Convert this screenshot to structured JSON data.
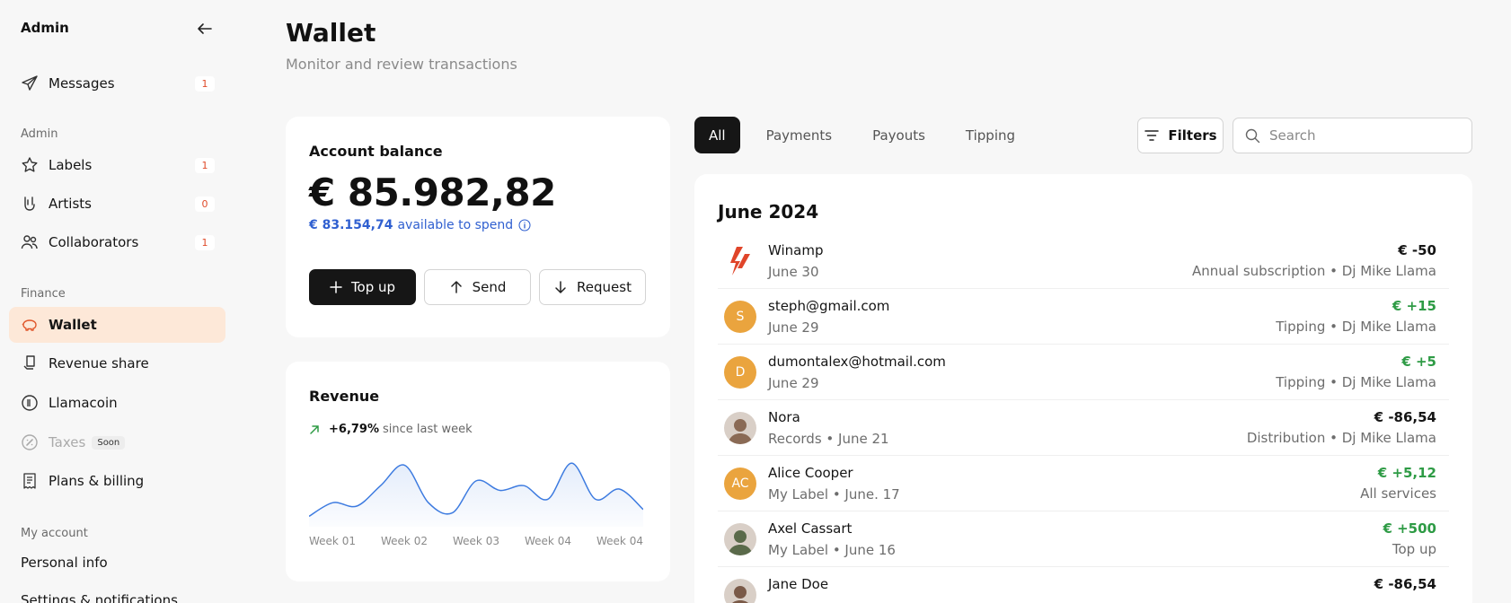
{
  "sidebar": {
    "header": "Admin",
    "top_items": [
      {
        "label": "Messages",
        "badge": "1"
      }
    ],
    "admin_section": "Admin",
    "admin_items": [
      {
        "label": "Labels",
        "badge": "1"
      },
      {
        "label": "Artists",
        "badge": "0"
      },
      {
        "label": "Collaborators",
        "badge": "1"
      }
    ],
    "finance_section": "Finance",
    "finance_items": [
      {
        "label": "Wallet"
      },
      {
        "label": "Revenue share"
      },
      {
        "label": "Llamacoin"
      },
      {
        "label": "Taxes",
        "tag": "Soon"
      },
      {
        "label": "Plans & billing"
      }
    ],
    "account_section": "My account",
    "account_items": [
      {
        "label": "Personal info"
      },
      {
        "label": "Settings & notifications"
      }
    ]
  },
  "header": {
    "title": "Wallet",
    "subtitle": "Monitor and review transactions"
  },
  "balance": {
    "title": "Account balance",
    "amount": "€ 85.982,82",
    "available_amount": "€ 83.154,74",
    "available_text": "available to spend",
    "buttons": {
      "top_up": "Top up",
      "send": "Send",
      "request": "Request"
    }
  },
  "revenue": {
    "title": "Revenue",
    "change": "+6,79%",
    "change_text": "since last week"
  },
  "chart_data": {
    "type": "area",
    "title": "Revenue",
    "categories": [
      "Week 01",
      "Week 02",
      "Week 03",
      "Week 04",
      "Week 04"
    ],
    "series": [
      {
        "values": [
          10,
          30,
          25,
          55,
          85,
          30,
          15,
          62,
          48,
          55,
          35,
          88,
          35,
          50,
          20
        ]
      }
    ],
    "ylim": [
      0,
      100
    ],
    "grid": false,
    "color": "#3d7be0"
  },
  "tabs": [
    "All",
    "Payments",
    "Payouts",
    "Tipping"
  ],
  "filters_label": "Filters",
  "search": {
    "placeholder": "Search"
  },
  "transactions": {
    "month": "June 2024",
    "rows": [
      {
        "name": "Winamp",
        "sub": "June 30",
        "amount": "€ -50",
        "desc": "Annual subscription • Dj Mike Llama",
        "positive": false,
        "avatar": "winamp-logo",
        "initials": ""
      },
      {
        "name": "steph@gmail.com",
        "sub": "June 29",
        "amount": "€ +15",
        "desc": "Tipping • Dj Mike Llama",
        "positive": true,
        "avatar": "initials",
        "initials": "S"
      },
      {
        "name": "dumontalex@hotmail.com",
        "sub": "June 29",
        "amount": "€ +5",
        "desc": "Tipping • Dj Mike Llama",
        "positive": true,
        "avatar": "initials",
        "initials": "D"
      },
      {
        "name": "Nora",
        "sub": "Records • June 21",
        "amount": "€ -86,54",
        "desc": "Distribution • Dj Mike Llama",
        "positive": false,
        "avatar": "photo",
        "initials": ""
      },
      {
        "name": "Alice Cooper",
        "sub": "My Label • June. 17",
        "amount": "€ +5,12",
        "desc": "All services",
        "positive": true,
        "avatar": "initials",
        "initials": "AC"
      },
      {
        "name": "Axel Cassart",
        "sub": "My Label • June 16",
        "amount": "€ +500",
        "desc": "Top up",
        "positive": true,
        "avatar": "photo",
        "initials": ""
      },
      {
        "name": "Jane Doe",
        "sub": "",
        "amount": "€ -86,54",
        "desc": "",
        "positive": false,
        "avatar": "photo",
        "initials": ""
      }
    ]
  },
  "colors": {
    "accent": "#161616",
    "active_nav": "#fde8d8",
    "link_blue": "#2f5fd0",
    "positive": "#2e9b45",
    "badge": "#e04b2a",
    "avatar_orange": "#eaa43e"
  }
}
